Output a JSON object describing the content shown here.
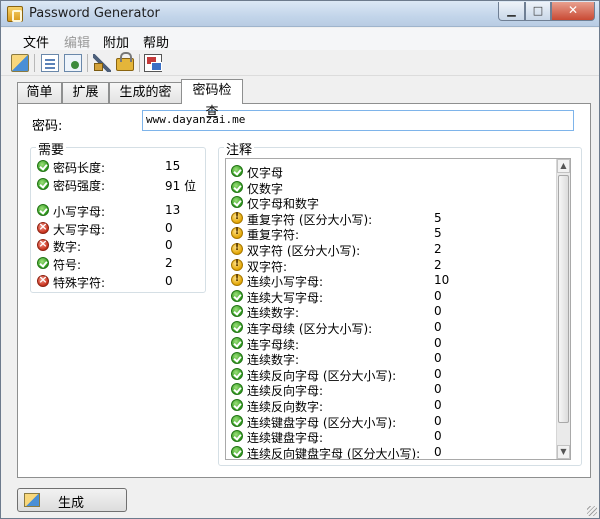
{
  "window": {
    "title": "Password Generator"
  },
  "menu": [
    {
      "label": "文件",
      "enabled": true
    },
    {
      "label": "编辑",
      "enabled": false
    },
    {
      "label": "附加",
      "enabled": true
    },
    {
      "label": "帮助",
      "enabled": true
    }
  ],
  "toolbar": [
    "generate-icon",
    "document-icon",
    "document-check-icon",
    "tools-icon",
    "lock-icon",
    "windows-icon"
  ],
  "tabs": [
    {
      "label": "简单",
      "active": false
    },
    {
      "label": "扩展",
      "active": false
    },
    {
      "label": "生成的密码",
      "active": false
    },
    {
      "label": "密码检查",
      "active": true
    }
  ],
  "password": {
    "label": "密码:",
    "value": "www.dayanzai.me"
  },
  "requirements": {
    "title": "需要",
    "items": [
      {
        "status": "ok",
        "label": "密码长度:",
        "value": "15"
      },
      {
        "status": "ok",
        "label": "密码强度:",
        "value": "91 位"
      },
      {
        "status": "ok",
        "label": "小写字母:",
        "value": "13"
      },
      {
        "status": "err",
        "label": "大写字母:",
        "value": "0"
      },
      {
        "status": "err",
        "label": "数字:",
        "value": "0"
      },
      {
        "status": "ok",
        "label": "符号:",
        "value": "2"
      },
      {
        "status": "err",
        "label": "特殊字符:",
        "value": "0"
      }
    ]
  },
  "notes": {
    "title": "注释",
    "items": [
      {
        "status": "ok",
        "label": "仅字母",
        "value": ""
      },
      {
        "status": "ok",
        "label": "仅数字",
        "value": ""
      },
      {
        "status": "ok",
        "label": "仅字母和数字",
        "value": ""
      },
      {
        "status": "warn",
        "label": "重复字符 (区分大小写):",
        "value": "5"
      },
      {
        "status": "warn",
        "label": "重复字符:",
        "value": "5"
      },
      {
        "status": "warn",
        "label": "双字符 (区分大小写):",
        "value": "2"
      },
      {
        "status": "warn",
        "label": "双字符:",
        "value": "2"
      },
      {
        "status": "warn",
        "label": "连续小写字母:",
        "value": "10"
      },
      {
        "status": "ok",
        "label": "连续大写字母:",
        "value": "0"
      },
      {
        "status": "ok",
        "label": "连续数字:",
        "value": "0"
      },
      {
        "status": "ok",
        "label": "连字母续 (区分大小写):",
        "value": "0"
      },
      {
        "status": "ok",
        "label": "连字母续:",
        "value": "0"
      },
      {
        "status": "ok",
        "label": "连续数字:",
        "value": "0"
      },
      {
        "status": "ok",
        "label": "连续反向字母 (区分大小写):",
        "value": "0"
      },
      {
        "status": "ok",
        "label": "连续反向字母:",
        "value": "0"
      },
      {
        "status": "ok",
        "label": "连续反向数字:",
        "value": "0"
      },
      {
        "status": "ok",
        "label": "连续键盘字母 (区分大小写):",
        "value": "0"
      },
      {
        "status": "ok",
        "label": "连续键盘字母:",
        "value": "0"
      },
      {
        "status": "ok",
        "label": "连续反向键盘字母 (区分大小写):",
        "value": "0"
      }
    ]
  },
  "generate_button": {
    "label": "生成"
  }
}
